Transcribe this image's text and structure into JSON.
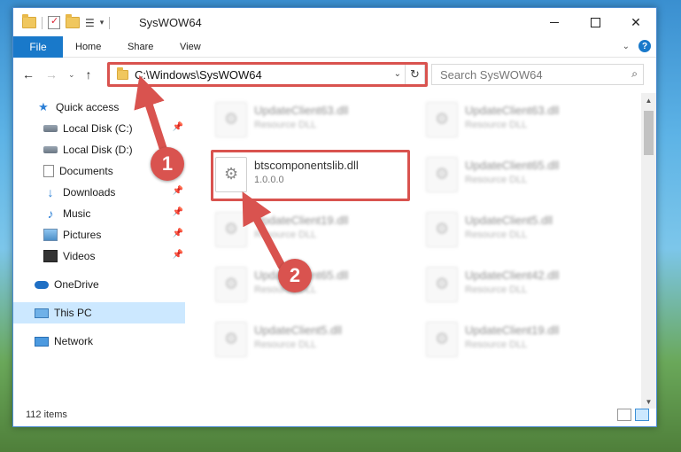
{
  "window": {
    "title": "SysWOW64"
  },
  "ribbon": {
    "file": "File",
    "home": "Home",
    "share": "Share",
    "view": "View"
  },
  "address": {
    "path": "C:\\Windows\\SysWOW64"
  },
  "search": {
    "placeholder": "Search SysWOW64"
  },
  "sidebar": {
    "quick_access": "Quick access",
    "items": [
      {
        "label": "Local Disk (C:)"
      },
      {
        "label": "Local Disk (D:)"
      },
      {
        "label": "Documents"
      },
      {
        "label": "Downloads"
      },
      {
        "label": "Music"
      },
      {
        "label": "Pictures"
      },
      {
        "label": "Videos"
      }
    ],
    "onedrive": "OneDrive",
    "this_pc": "This PC",
    "network": "Network"
  },
  "files": [
    {
      "name": "UpdateClient63.dll",
      "type": "Resource DLL"
    },
    {
      "name": "UpdateClient63.dll",
      "type": "Resource DLL"
    },
    {
      "name": "btscomponentslib.dll",
      "type": "1.0.0.0"
    },
    {
      "name": "UpdateClient65.dll",
      "type": "Resource DLL"
    },
    {
      "name": "UpdateClient19.dll",
      "type": "Resource DLL"
    },
    {
      "name": "UpdateClient5.dll",
      "type": "Resource DLL"
    },
    {
      "name": "UpdateClient65.dll",
      "type": "Resource DLL"
    },
    {
      "name": "UpdateClient42.dll",
      "type": "Resource DLL"
    },
    {
      "name": "UpdateClient5.dll",
      "type": "Resource DLL"
    },
    {
      "name": "UpdateClient19.dll",
      "type": "Resource DLL"
    }
  ],
  "status": {
    "items": "112 items"
  },
  "callouts": {
    "one": "1",
    "two": "2"
  },
  "colors": {
    "accent": "#1979ca",
    "highlight": "#d9534f",
    "selected": "#cce8ff"
  }
}
